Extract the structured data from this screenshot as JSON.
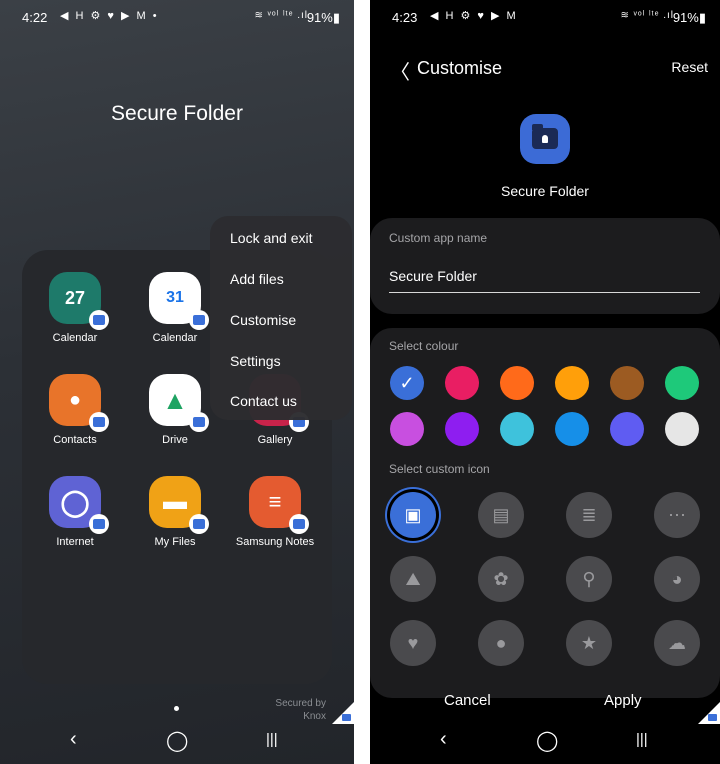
{
  "left": {
    "status": {
      "time": "4:22",
      "notif_icons": "◀ H ⚙ ♥ ▶ M •",
      "signal": "≋ ᵛᵒˡ ˡᵗᵉ .ıl",
      "battery": "91%▮"
    },
    "title": "Secure Folder",
    "apps": [
      {
        "label": "Calendar",
        "icon": "calendar-icon",
        "glyph": "27",
        "color": "#1e7a6a"
      },
      {
        "label": "Calendar",
        "icon": "google-calendar-icon",
        "glyph": "31",
        "color": "#ffffff"
      },
      {
        "label": "Contacts",
        "icon": "contacts-icon",
        "glyph": "●",
        "color": "#e8742a"
      },
      {
        "label": "Drive",
        "icon": "drive-icon",
        "glyph": "▲",
        "color": "#ffffff"
      },
      {
        "label": "Gallery",
        "icon": "gallery-icon",
        "glyph": "",
        "color": "#c8234a"
      },
      {
        "label": "Internet",
        "icon": "internet-icon",
        "glyph": "◯",
        "color": "#5f63d4"
      },
      {
        "label": "My Files",
        "icon": "my-files-icon",
        "glyph": "▬",
        "color": "#f0a216"
      },
      {
        "label": "Samsung Notes",
        "icon": "samsung-notes-icon",
        "glyph": "≡",
        "color": "#e45b30"
      }
    ],
    "menu": [
      "Lock and exit",
      "Add files",
      "Customise",
      "Settings",
      "Contact us"
    ],
    "secured_by": "Secured by",
    "knox": "Knox",
    "nav": {
      "back": "‹",
      "home": "◯",
      "recents": "|||"
    }
  },
  "right": {
    "status": {
      "time": "4:23",
      "notif_icons": "◀ H ⚙ ♥ ▶ M",
      "signal": "≋ ᵛᵒˡ ˡᵗᵉ .ıl",
      "battery": "91%▮"
    },
    "header": {
      "back": "〈",
      "title": "Customise",
      "reset": "Reset"
    },
    "preview_name": "Secure Folder",
    "name_card": {
      "label": "Custom app name",
      "value": "Secure Folder"
    },
    "colour_label": "Select colour",
    "colours": [
      "#3a6fd8",
      "#e91e63",
      "#ff6a1a",
      "#ff9f0a",
      "#9c5b22",
      "#1ec97a",
      "#c84fe0",
      "#8e1ef0",
      "#3ec2dc",
      "#168fe8",
      "#5f5cf2",
      "#e6e6e6"
    ],
    "selected_colour_check": "✓",
    "icon_label": "Select custom icon",
    "icons": [
      {
        "name": "folder-lock-icon",
        "glyph": "▣"
      },
      {
        "name": "briefcase-icon",
        "glyph": "▤"
      },
      {
        "name": "document-icon",
        "glyph": "≣"
      },
      {
        "name": "chat-bubble-icon",
        "glyph": "⋯"
      },
      {
        "name": "landscape-icon",
        "glyph": "⛰"
      },
      {
        "name": "flower-icon",
        "glyph": "✿"
      },
      {
        "name": "bicycle-icon",
        "glyph": "⚲"
      },
      {
        "name": "dog-icon",
        "glyph": "◕"
      },
      {
        "name": "heart-face-icon",
        "glyph": "♥"
      },
      {
        "name": "piggy-bank-icon",
        "glyph": "●"
      },
      {
        "name": "star-face-icon",
        "glyph": "★"
      },
      {
        "name": "cloud-face-icon",
        "glyph": "☁"
      }
    ],
    "cancel": "Cancel",
    "apply": "Apply",
    "nav": {
      "back": "‹",
      "home": "◯",
      "recents": "|||"
    }
  }
}
